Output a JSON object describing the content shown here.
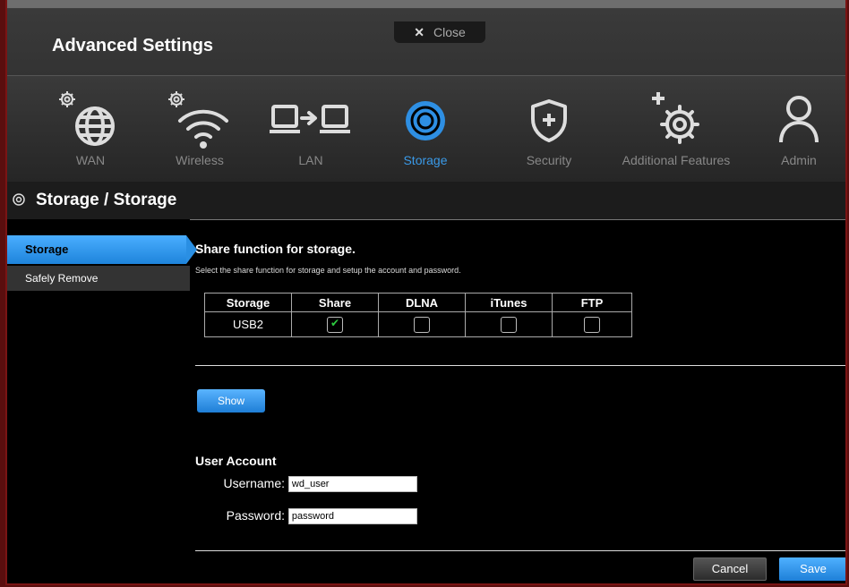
{
  "header": {
    "title": "Advanced Settings",
    "close_label": "Close"
  },
  "nav": {
    "items": [
      {
        "label": "WAN",
        "icon": "globe-gear-icon"
      },
      {
        "label": "Wireless",
        "icon": "wifi-gear-icon"
      },
      {
        "label": "LAN",
        "icon": "lan-computers-icon"
      },
      {
        "label": "Storage",
        "icon": "storage-disc-icon",
        "active": true
      },
      {
        "label": "Security",
        "icon": "shield-plus-icon"
      },
      {
        "label": "Additional Features",
        "icon": "gear-plus-icon"
      },
      {
        "label": "Admin",
        "icon": "person-icon"
      }
    ],
    "active_color": "#3a9ae8"
  },
  "breadcrumb": {
    "text": "Storage / Storage"
  },
  "sidebar": {
    "items": [
      {
        "label": "Storage",
        "active": true
      },
      {
        "label": "Safely Remove",
        "active": false
      }
    ]
  },
  "main": {
    "heading": "Share function for storage.",
    "description": "Select the share function for storage and setup the account and password.",
    "table": {
      "headers": [
        "Storage",
        "Share",
        "DLNA",
        "iTunes",
        "FTP"
      ],
      "rows": [
        {
          "storage": "USB2",
          "share": true,
          "dlna": false,
          "itunes": false,
          "ftp": false
        }
      ]
    },
    "show_button": "Show",
    "user_account": {
      "title": "User Account",
      "username_label": "Username:",
      "username_value": "wd_user",
      "password_label": "Password:",
      "password_value": "password"
    },
    "cancel_button": "Cancel",
    "save_button": "Save"
  }
}
